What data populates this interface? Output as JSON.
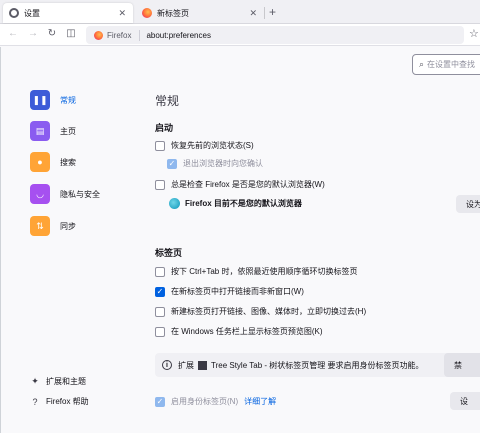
{
  "tabs": [
    {
      "label": "设置",
      "active": true
    },
    {
      "label": "新标签页",
      "active": false
    }
  ],
  "urlbar": {
    "identity": "Firefox",
    "url": "about:preferences"
  },
  "search": {
    "placeholder": "在设置中查找"
  },
  "sidebar": {
    "items": [
      {
        "label": "常规",
        "selected": true
      },
      {
        "label": "主页"
      },
      {
        "label": "搜索"
      },
      {
        "label": "隐私与安全"
      },
      {
        "label": "同步"
      }
    ],
    "footer": [
      {
        "label": "扩展和主题"
      },
      {
        "label": "Firefox 帮助"
      }
    ]
  },
  "main": {
    "title": "常规",
    "startup": {
      "heading": "启动",
      "restore_session": {
        "label": "恢复先前的浏览状态(S)",
        "checked": false
      },
      "warn_on_quit": {
        "label": "退出浏览器时向您确认",
        "checked": true,
        "disabled": true
      },
      "check_default": {
        "label": "总是检查 Firefox 是否是您的默认浏览器(W)",
        "checked": false
      },
      "default_status": "Firefox 目前不是您的默认浏览器",
      "set_default_button": "设为"
    },
    "tabs_section": {
      "heading": "标签页",
      "ctrl_tab": {
        "label": "按下 Ctrl+Tab 时，依照最近使用顺序循环切换标签页",
        "checked": false
      },
      "open_links_in_tabs": {
        "label": "在新标签页中打开链接而非新窗口(W)",
        "checked": true
      },
      "switch_to_new_tab": {
        "label": "新建标签页打开链接、图像、媒体时，立即切换过去(H)",
        "checked": false
      },
      "taskbar_previews": {
        "label": "在 Windows 任务栏上显示标签页预览图(K)",
        "checked": false
      },
      "extension_notice": {
        "prefix": "扩展",
        "text": "Tree Style Tab - 树状标签页管理 要求启用身份标签页功能。",
        "button": "禁"
      },
      "containers": {
        "label": "启用身份标签页(N)",
        "checked": true,
        "disabled": true,
        "link": "详细了解",
        "button": "设"
      }
    }
  },
  "colors": {
    "accent": "#0061e0",
    "background": "#f9f9fb"
  }
}
